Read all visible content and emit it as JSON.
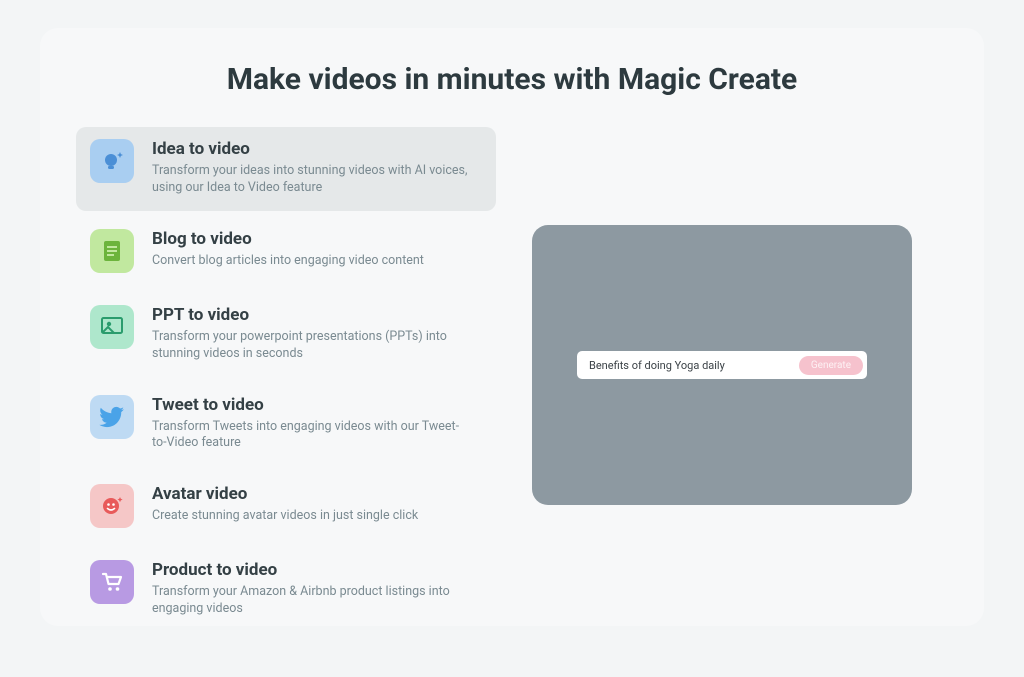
{
  "heading": "Make videos in minutes with Magic Create",
  "options": [
    {
      "title": "Idea to video",
      "desc": "Transform your ideas into stunning videos with AI voices, using our Idea to Video feature",
      "icon_bg": "#a9cef1",
      "icon_name": "bulb-sparkle-icon",
      "selected": true
    },
    {
      "title": "Blog to video",
      "desc": "Convert blog articles into engaging video content",
      "icon_bg": "#c1e89f",
      "icon_name": "document-icon",
      "selected": false
    },
    {
      "title": "PPT to video",
      "desc": "Transform your powerpoint presentations (PPTs) into stunning videos in seconds",
      "icon_bg": "#aee7cc",
      "icon_name": "presentation-icon",
      "selected": false
    },
    {
      "title": "Tweet to video",
      "desc": "Transform Tweets into engaging videos with our Tweet-to-Video feature",
      "icon_bg": "#bedaf3",
      "icon_name": "twitter-bird-icon",
      "selected": false
    },
    {
      "title": "Avatar video",
      "desc": "Create stunning avatar videos in just single click",
      "icon_bg": "#f5c7c7",
      "icon_name": "avatar-face-icon",
      "selected": false
    },
    {
      "title": "Product to video",
      "desc": "Transform your Amazon & Airbnb product listings into engaging videos",
      "icon_bg": "#b89ae3",
      "icon_name": "shopping-cart-icon",
      "selected": false
    }
  ],
  "preview": {
    "prompt": "Benefits of doing Yoga daily",
    "button_label": "Generate"
  }
}
